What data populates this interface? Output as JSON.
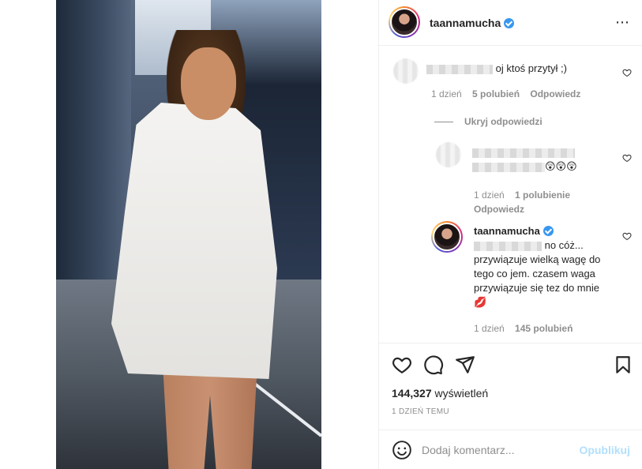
{
  "post": {
    "username": "taannamucha",
    "more_icon": "⋯"
  },
  "comments": {
    "c1": {
      "text": " oj ktoś przytył ;)",
      "time": "1 dzień",
      "likes": "5 polubień",
      "reply": "Odpowiedz"
    },
    "hide_replies": "Ukryj odpowiedzi",
    "c2": {
      "emoji": "😲😲😲",
      "time": "1 dzień",
      "likes": "1 polubienie",
      "reply": "Odpowiedz"
    },
    "c3": {
      "username": "taannamucha",
      "line1": " no cóż...",
      "line2": "przywiązuje wielką wagę do",
      "line3": "tego co jem. czasem waga",
      "line4": "przywiązuje się tez do mnie",
      "emoji": "💋",
      "time": "1 dzień",
      "likes": "145 polubień"
    }
  },
  "actions": {
    "views_count": "144,327",
    "views_label": " wyświetleń",
    "timestamp": "1 DZIEŃ TEMU"
  },
  "add_comment": {
    "placeholder": "Dodaj komentarz...",
    "post_label": "Opublikuj"
  },
  "colors": {
    "verified": "#3897f0",
    "post_button_disabled": "#b2dffc",
    "meta_text": "#8e8e8e"
  }
}
